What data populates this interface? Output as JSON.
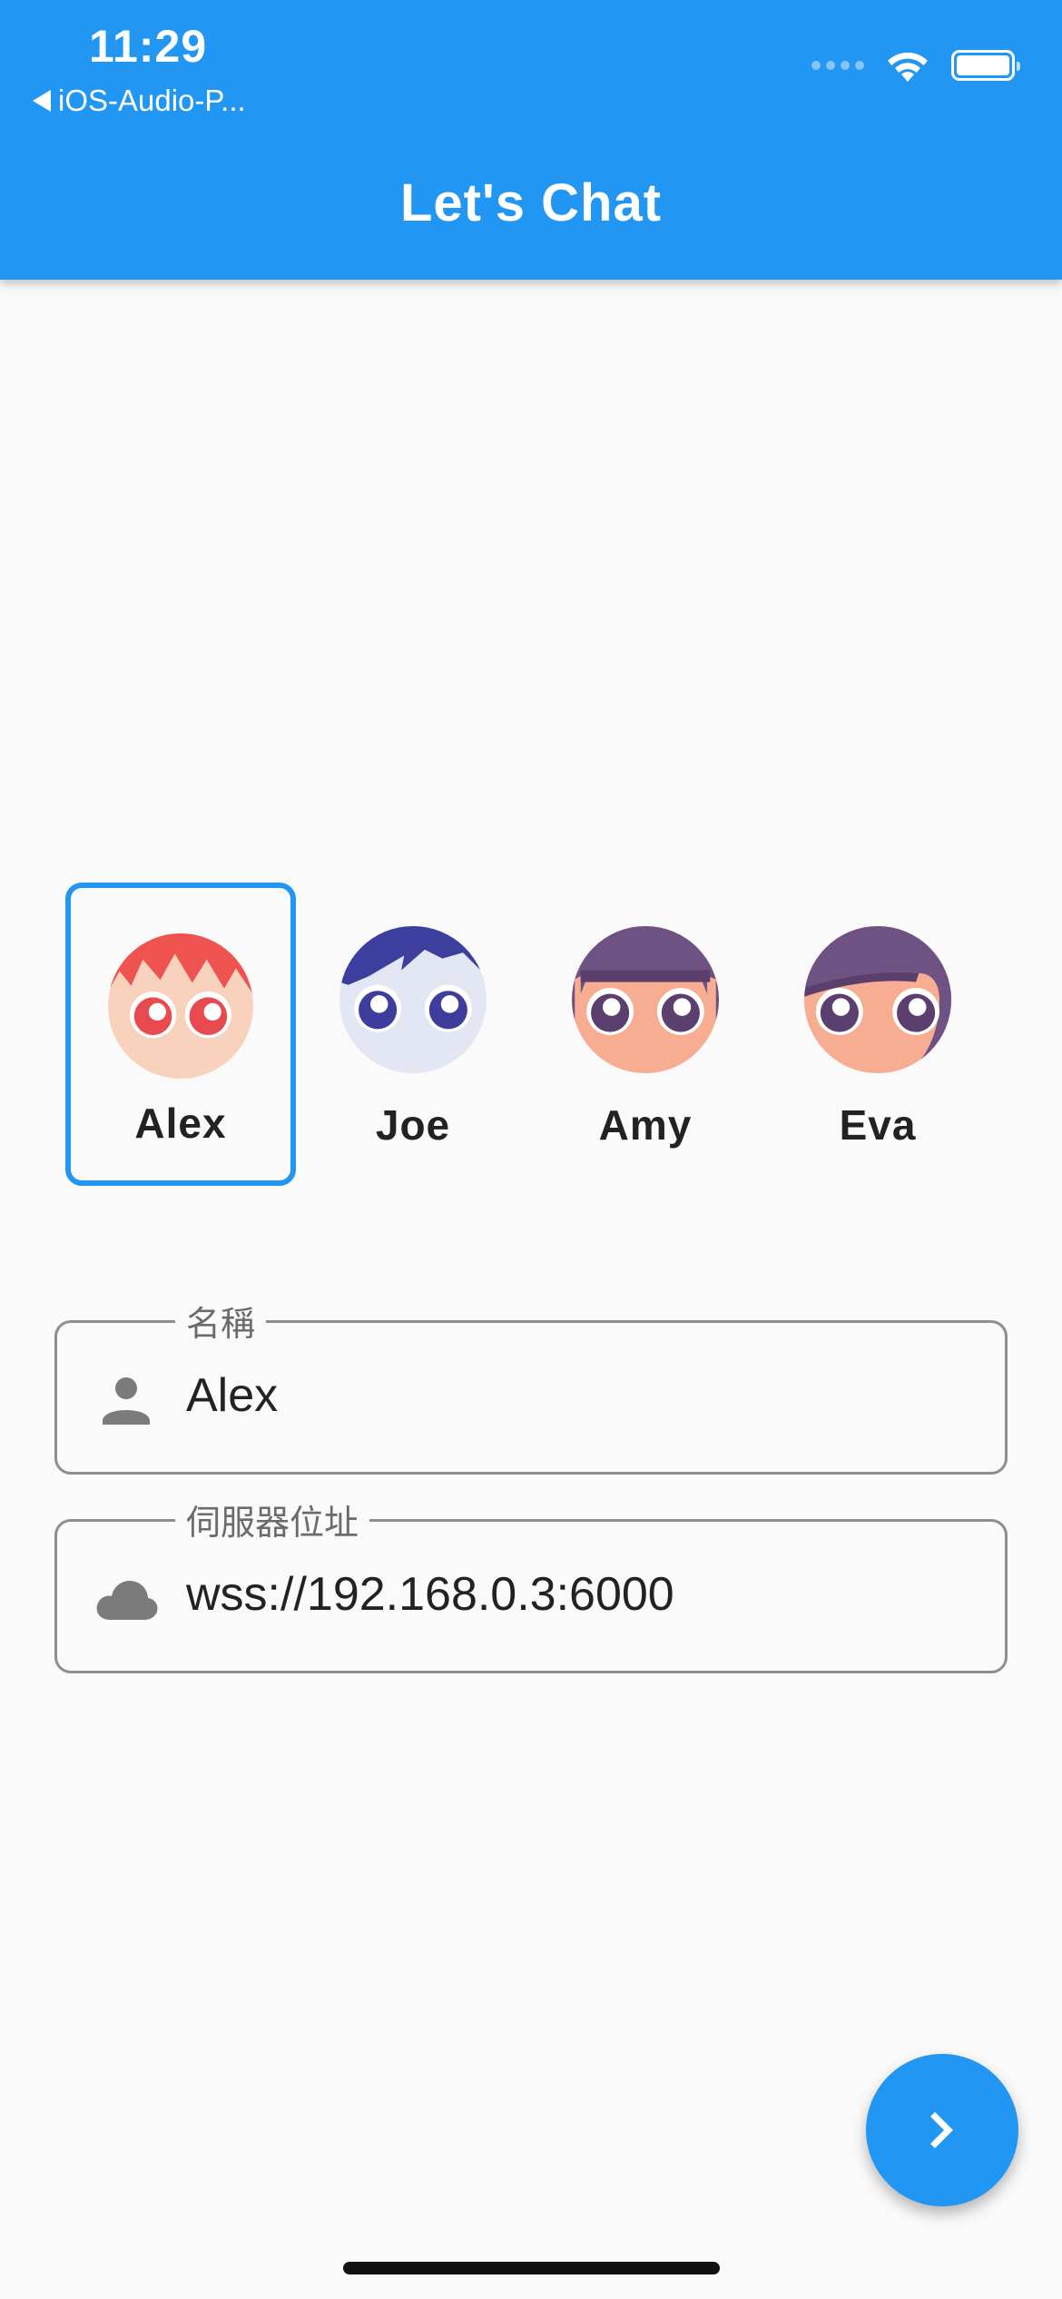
{
  "status_bar": {
    "time": "11:29",
    "back_app_label": "iOS-Audio-P..."
  },
  "app_bar": {
    "title": "Let's Chat"
  },
  "avatars": [
    {
      "name": "Alex",
      "selected": true
    },
    {
      "name": "Joe",
      "selected": false
    },
    {
      "name": "Amy",
      "selected": false
    },
    {
      "name": "Eva",
      "selected": false
    }
  ],
  "form": {
    "name_field": {
      "label": "名稱",
      "value": "Alex",
      "icon": "person-icon"
    },
    "server_field": {
      "label": "伺服器位址",
      "value": "wss://192.168.0.3:6000",
      "icon": "cloud-icon"
    }
  },
  "fab": {
    "icon": "chevron-right-icon"
  },
  "colors": {
    "primary": "#2196f3",
    "background": "#fafafa",
    "field_border": "#8e8e8e"
  }
}
